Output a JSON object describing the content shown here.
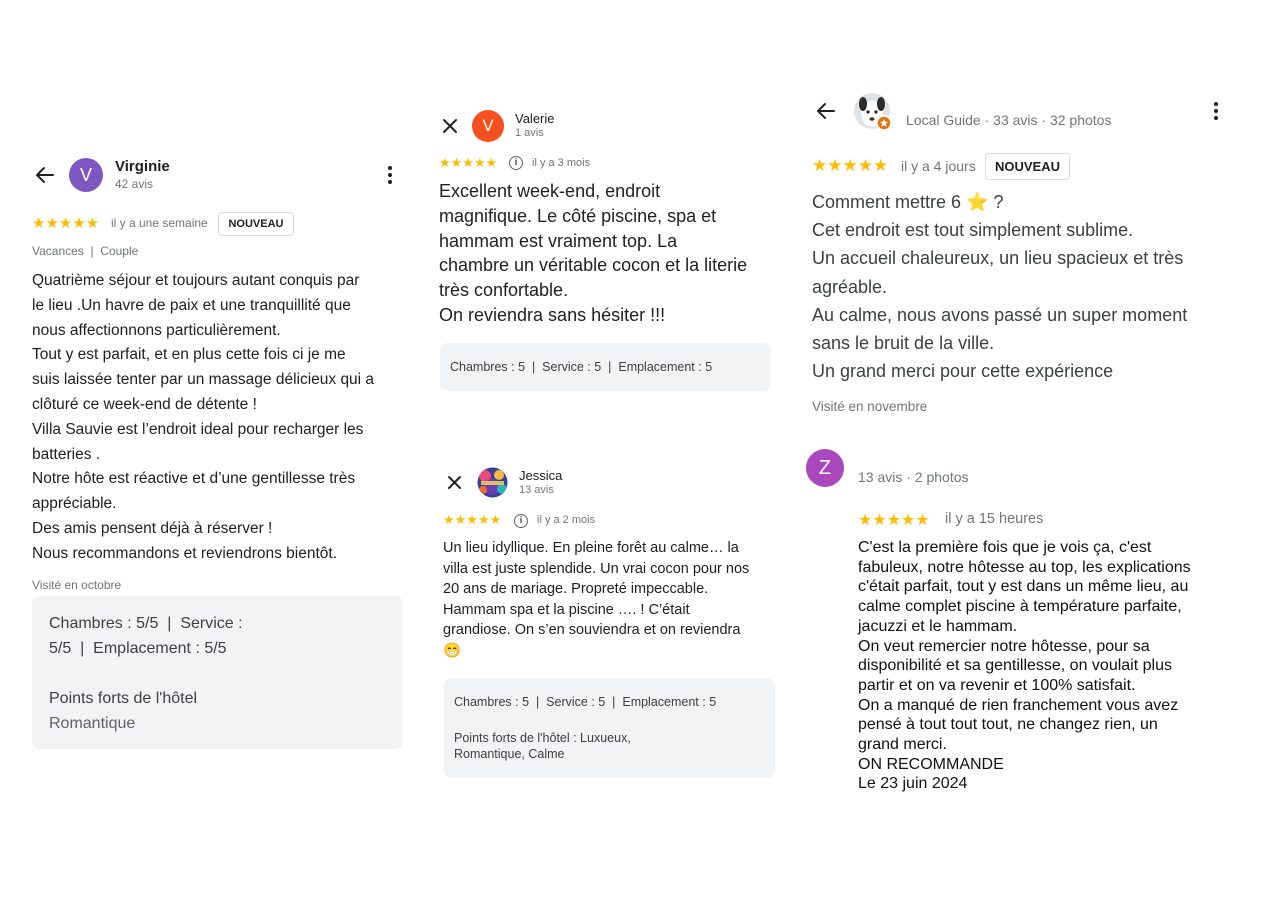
{
  "colors": {
    "star": "#fbbc04",
    "avatar_purple": "#7e57c2",
    "avatar_orange": "#f4511e",
    "avatar_magenta": "#ab47bc",
    "box_bg": "#f1f3f4"
  },
  "review1": {
    "avatar_letter": "V",
    "name": "Virginie",
    "count": "42 avis",
    "stars": "★★★★★",
    "ago": "il y a une semaine",
    "badge": "NOUVEAU",
    "tags": "Vacances  |  Couple",
    "text": "Quatrième séjour et toujours autant conquis par\nle lieu .Un havre de paix et une tranquillité que\nnous affectionnons particulièrement.\nTout y est parfait, et en plus cette fois ci je me\nsuis laissée tenter par un massage délicieux qui a\nclôturé ce week-end de détente !\nVilla Sauvie est l’endroit ideal pour recharger les\nbatteries .\nNotre hôte est réactive et d’une gentillesse très\nappréciable.\nDes amis pensent déjà à réserver !\nNous recommandons et reviendrons bientôt.",
    "visited": "Visité en octobre",
    "ratings_line1": "Chambres : 5/5  |  Service :",
    "ratings_line2": "5/5  |  Emplacement : 5/5",
    "highlights_title": "Points forts de l'hôtel",
    "highlights_value": "Romantique"
  },
  "review2": {
    "avatar_letter": "V",
    "name": "Valerie",
    "count": "1 avis",
    "stars": "★★★★★",
    "ago": "il y a 3 mois",
    "text": "Excellent week-end, endroit\nmagnifique. Le côté piscine, spa et\nhammam est vraiment top. La\nchambre un véritable cocon et la literie\ntrès confortable.\nOn reviendra sans hésiter !!!",
    "ratings": "Chambres : 5  |  Service : 5  |  Emplacement : 5"
  },
  "review3": {
    "name": "Jessica",
    "count": "13 avis",
    "stars": "★★★★★",
    "ago": "il y a 2 mois",
    "text": "Un lieu idyllique. En pleine forêt au calme… la\nvilla est juste splendide. Un vrai cocon pour nos\n20 ans de mariage. Propreté impeccable.\nHammam spa et la piscine …. ! C’était\ngrandiose. On s’en souviendra et on reviendra\n😁",
    "ratings": "Chambres : 5  |  Service : 5  |  Emplacement : 5",
    "highlights": "Points forts de l'hôtel : Luxueux,\nRomantique, Calme"
  },
  "review4": {
    "meta": "Local Guide · 33 avis · 32 photos",
    "stars": "★★★★★",
    "ago": "il y a 4 jours",
    "badge": "NOUVEAU",
    "text": "Comment mettre 6 ⭐ ?\nCet endroit est tout simplement sublime.\nUn accueil chaleureux, un lieu spacieux et très\nagréable.\nAu calme, nous avons passé un super moment\nsans le bruit de la ville.\nUn grand merci pour cette expérience",
    "visited": "Visité en novembre"
  },
  "review5": {
    "avatar_letter": "Z",
    "meta": "13 avis · 2 photos",
    "stars": "★★★★★",
    "ago": "il y a 15 heures",
    "text": "C'est la première fois que je vois ça, c'est\nfabuleux, notre hôtesse au top, les explications\nc'était parfait, tout y est dans un même lieu, au\ncalme complet piscine à température parfaite,\njacuzzi et le hammam.\nOn veut remercier notre hôtesse, pour sa\ndisponibilité et sa gentillesse, on voulait plus\npartir et on va revenir et 100% satisfait.\nOn a manqué de rien franchement vous avez\npensé à tout tout tout, ne changez rien, un\ngrand merci.\nON RECOMMANDE\nLe 23 juin 2024"
  }
}
